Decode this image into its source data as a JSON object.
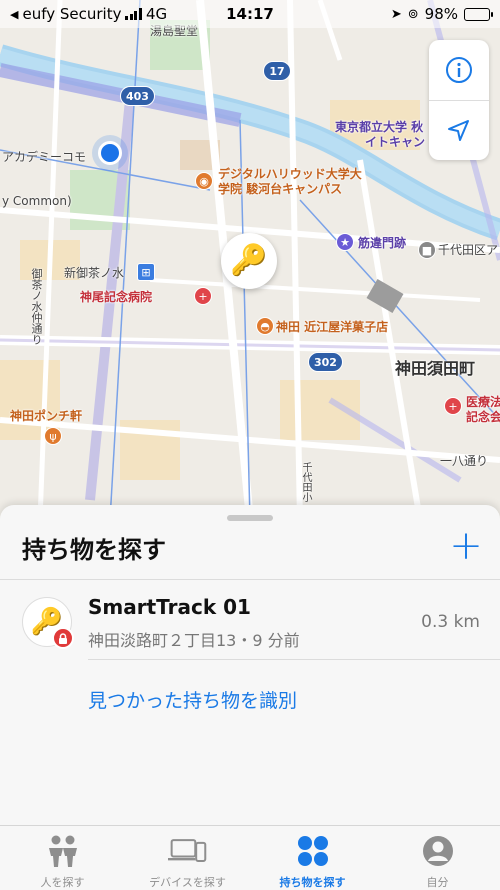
{
  "status_bar": {
    "back_app": "eufy Security",
    "network": "4G",
    "time": "14:17",
    "battery": "98%",
    "battery_level": 0.98
  },
  "map": {
    "labels": {
      "top_station": "湯島聖堂",
      "univ_top": "東京都立大学 秋",
      "univ_top2": "イトキャン",
      "academy": "アカデミーコモ",
      "common": "y Common)",
      "digital_univ": "デジタルハリウッド大学大",
      "digital_univ2": "学院 駿河台キャンパス",
      "sujikai": "筋違門跡",
      "chiyoda": "千代田区ア",
      "ochanomizu": "新御茶ノ水",
      "kamio": "神尾記念病院",
      "omiya": "神田 近江屋洋菓子店",
      "kanda_sudacho": "神田須田町",
      "ponchiken": "神田ポンチ軒",
      "medical": "医療法",
      "kinenkai": "記念会",
      "hachiro": "一八通り",
      "ochanomizu_dori": "御茶ノ水仲通り",
      "chiyoda_small": "千代田小"
    },
    "routes": [
      "403",
      "17",
      "302"
    ]
  },
  "sheet": {
    "title": "持ち物を探す",
    "add_label": "+",
    "item": {
      "name": "SmartTrack 01",
      "subtitle": "神田淡路町２丁目13・9 分前",
      "distance": "0.3 km"
    },
    "identify_link": "見つかった持ち物を識別"
  },
  "tabs": [
    {
      "label": "人を探す",
      "icon": "people-icon",
      "active": false
    },
    {
      "label": "デバイスを探す",
      "icon": "devices-icon",
      "active": false
    },
    {
      "label": "持ち物を探す",
      "icon": "items-icon",
      "active": true
    },
    {
      "label": "自分",
      "icon": "me-icon",
      "active": false
    }
  ],
  "colors": {
    "accent": "#1a7ae6",
    "lock_red": "#e03a3a",
    "route_blue": "#2f5fa8"
  }
}
